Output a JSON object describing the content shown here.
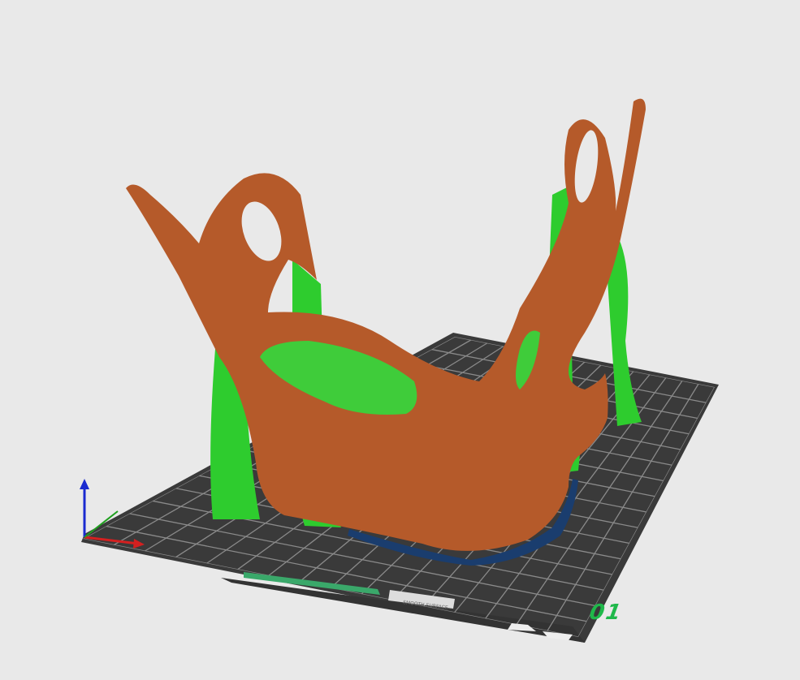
{
  "viewport": {
    "plate_number": "01",
    "plate_label": "SMOOTH SURFACE",
    "colors": {
      "background": "#e9e9e9",
      "build_plate": "#3a3a3a",
      "grid": "#8a8a8a",
      "model": "#b55a2a",
      "supports": "#2ecc2e",
      "skirt": "#1a3d6e",
      "plate_number": "#1fb84a",
      "axis_x": "#d42020",
      "axis_y": "#20a020",
      "axis_z": "#1a2ad0"
    }
  }
}
